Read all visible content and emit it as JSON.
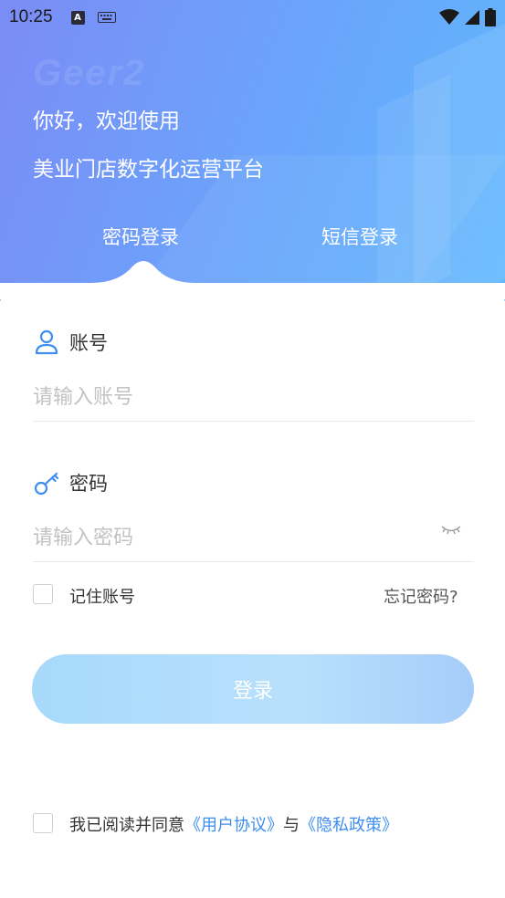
{
  "status_bar": {
    "time": "10:25",
    "input_badge": "A",
    "icons": [
      "keyboard-icon",
      "wifi-icon",
      "cell-signal-icon",
      "battery-icon"
    ]
  },
  "header": {
    "watermark": "Geer2",
    "greeting": "你好，欢迎使用",
    "platform_name": "美业门店数字化运营平台"
  },
  "tabs": [
    {
      "label": "密码登录",
      "active": true
    },
    {
      "label": "短信登录",
      "active": false
    }
  ],
  "account": {
    "label": "账号",
    "placeholder": "请输入账号",
    "value": ""
  },
  "password": {
    "label": "密码",
    "placeholder": "请输入密码",
    "value": ""
  },
  "remember": {
    "label": "记住账号",
    "checked": false
  },
  "forgot_label": "忘记密码?",
  "login_button": "登录",
  "agreement": {
    "checked": false,
    "prefix": "我已阅读并同意",
    "user_agreement": "《用户协议》",
    "conjunction": "与",
    "privacy_policy": "《隐私政策》"
  },
  "colors": {
    "accent": "#3d8ef0",
    "header_start": "#7b8cf6",
    "header_end": "#5fb8fd",
    "button": "#a7d9fb"
  }
}
